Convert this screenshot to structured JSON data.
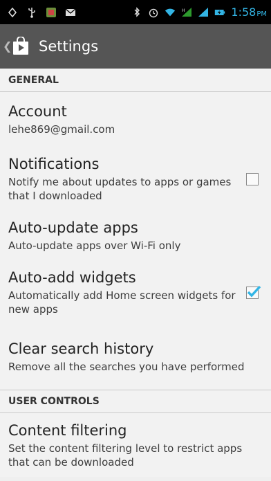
{
  "status_bar": {
    "time": "1:58",
    "ampm": "PM",
    "icons": [
      "sync-icon",
      "usb-icon",
      "app-notification-icon",
      "email-icon",
      "bluetooth-icon",
      "alarm-icon",
      "wifi-icon",
      "signal-icon",
      "signal-icon",
      "battery-charging-icon"
    ]
  },
  "action_bar": {
    "title": "Settings",
    "icon": "play-store-icon"
  },
  "sections": {
    "general": {
      "header": "GENERAL"
    },
    "user_controls": {
      "header": "USER CONTROLS"
    }
  },
  "prefs": {
    "account": {
      "title": "Account",
      "summary": "lehe869@gmail.com"
    },
    "notifications": {
      "title": "Notifications",
      "summary": "Notify me about updates to apps or games that I downloaded",
      "checked": false
    },
    "auto_update": {
      "title": "Auto-update apps",
      "summary": "Auto-update apps over Wi-Fi only"
    },
    "auto_add_widgets": {
      "title": "Auto-add widgets",
      "summary": "Automatically add Home screen widgets for new apps",
      "checked": true
    },
    "clear_search": {
      "title": "Clear search history",
      "summary": "Remove all the searches you have performed"
    },
    "content_filtering": {
      "title": "Content filtering",
      "summary": "Set the content filtering level to restrict apps that can be downloaded"
    }
  },
  "colors": {
    "accent": "#33b5e5",
    "action_bar": "#555555",
    "background": "#f2f2f2"
  }
}
